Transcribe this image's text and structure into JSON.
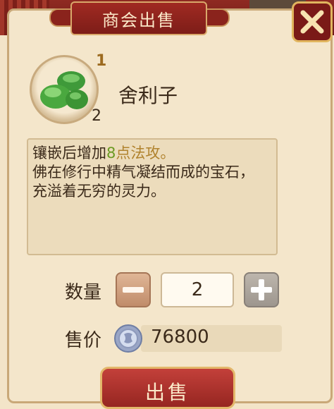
{
  "dialog": {
    "title": "商会出售"
  },
  "item": {
    "name": "舍利子",
    "grade": "1",
    "count": "2",
    "icon": "green-gem-icon"
  },
  "description": {
    "line1_prefix": "镶嵌后增加",
    "line1_value": "8",
    "line1_suffix": "点法攻。",
    "line2": "佛在修行中精气凝结而成的宝石，",
    "line3": "充溢着无穷的灵力。"
  },
  "quantity": {
    "label": "数量",
    "value": "2"
  },
  "price": {
    "label": "售价",
    "value": "76800",
    "icon": "silver-coin-icon"
  },
  "sell_button": {
    "label": "出售"
  },
  "colors": {
    "banner": "#8f2a22",
    "panel": "#f4e6cb",
    "highlight_green": "#6a9a22",
    "gold_text": "#b0822d"
  }
}
